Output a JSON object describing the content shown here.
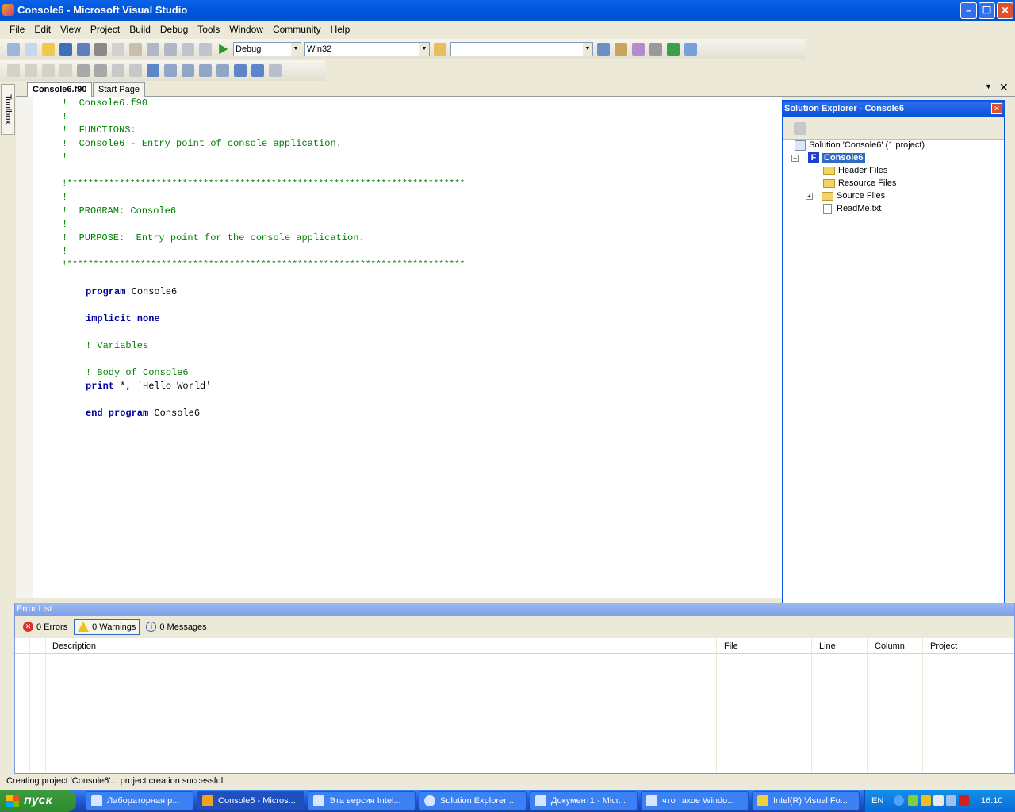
{
  "window": {
    "title": "Console6 - Microsoft Visual Studio"
  },
  "menu": [
    "File",
    "Edit",
    "View",
    "Project",
    "Build",
    "Debug",
    "Tools",
    "Window",
    "Community",
    "Help"
  ],
  "toolbar": {
    "config": "Debug",
    "platform": "Win32",
    "find": ""
  },
  "toolbox": {
    "label": "Toolbox"
  },
  "tabs": [
    {
      "label": "Console6.f90"
    },
    {
      "label": "Start Page"
    }
  ],
  "code": {
    "lines": [
      {
        "t": "cm",
        "v": "!  Console6.f90"
      },
      {
        "t": "cm",
        "v": "!"
      },
      {
        "t": "cm",
        "v": "!  FUNCTIONS:"
      },
      {
        "t": "cm",
        "v": "!  Console6 - Entry point of console application."
      },
      {
        "t": "cm",
        "v": "!"
      },
      {
        "t": "cm",
        "v": ""
      },
      {
        "t": "cm",
        "v": "!****************************************************************************"
      },
      {
        "t": "cm",
        "v": "!"
      },
      {
        "t": "cm",
        "v": "!  PROGRAM: Console6"
      },
      {
        "t": "cm",
        "v": "!"
      },
      {
        "t": "cm",
        "v": "!  PURPOSE:  Entry point for the console application."
      },
      {
        "t": "cm",
        "v": "!"
      },
      {
        "t": "cm",
        "v": "!****************************************************************************"
      }
    ],
    "body": {
      "program_kw": "program",
      "program_name": "Console6",
      "implicit_kw": "implicit none",
      "variables_cm": "! Variables",
      "body_cm": "! Body of Console6",
      "print_kw": "print",
      "print_rest": " *, 'Hello World'",
      "end_kw": "end program",
      "end_name": "Console6"
    }
  },
  "solution_explorer": {
    "title": "Solution Explorer - Console6",
    "solution": "Solution 'Console6' (1 project)",
    "project": "Console6",
    "items": [
      "Header Files",
      "Resource Files",
      "Source Files",
      "ReadMe.txt"
    ]
  },
  "error_list": {
    "title": "Error List",
    "errors": "0 Errors",
    "warnings": "0 Warnings",
    "messages": "0 Messages",
    "columns": [
      "Description",
      "File",
      "Line",
      "Column",
      "Project"
    ]
  },
  "status": "Creating project 'Console6'... project creation successful.",
  "taskbar": {
    "start": "пуск",
    "tasks": [
      "Лабораторная р...",
      "Console5 - Micros...",
      "Эта версия Intel...",
      "Solution Explorer ...",
      "Документ1 - Micr...",
      "что такое Windo...",
      "Intel(R) Visual Fo..."
    ],
    "lang": "EN",
    "clock": "16:10"
  },
  "colors": {
    "comment": "#008000",
    "keyword": "#00009c",
    "title_bar": "#0058e0"
  }
}
